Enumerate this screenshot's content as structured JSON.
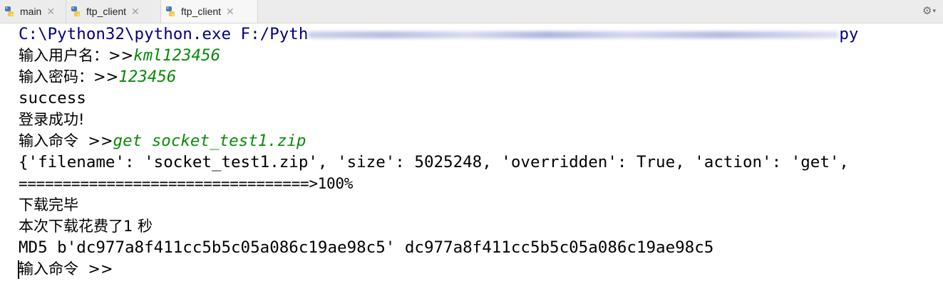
{
  "tabs": [
    {
      "label": "main",
      "icon": "python-icon",
      "active": false
    },
    {
      "label": "ftp_client",
      "icon": "python-icon",
      "active": false
    },
    {
      "label": "ftp_client",
      "icon": "python-icon",
      "active": true
    }
  ],
  "toolbar": {
    "settings_icon": "gear-icon"
  },
  "console": {
    "command_prefix": "C:\\Python32\\python.exe F:/Pyth",
    "command_end": "py",
    "user_prompt": "输入用户名：>>",
    "user_input": "kml123456",
    "pwd_prompt": "输入密码：>>",
    "pwd_input": "123456",
    "status": "success",
    "login_msg": "登录成功!",
    "cmd_prompt": "输入命令  >>",
    "cmd_input": "get socket_test1.zip",
    "header_info": "{'filename': 'socket_test1.zip', 'size': 5025248, 'overridden': True, 'action': 'get',",
    "progress": "=================================>100%",
    "download_done": "下载完毕",
    "time_msg": "本次下载花费了1 秒",
    "md5_line": "MD5 b'dc977a8f411cc5b5c05a086c19ae98c5' dc977a8f411cc5b5c05a086c19ae98c5",
    "cmd_prompt2": "输入命令  >>"
  },
  "colors": {
    "command": "#000080",
    "user_input": "#0a8a0a",
    "text": "#000000"
  }
}
